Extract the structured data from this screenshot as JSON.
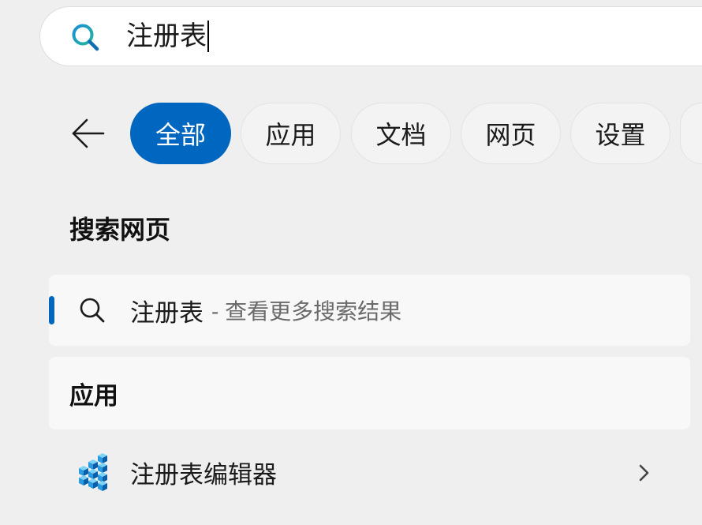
{
  "search": {
    "query": "注册表"
  },
  "filters": [
    {
      "label": "全部",
      "selected": true
    },
    {
      "label": "应用",
      "selected": false
    },
    {
      "label": "文档",
      "selected": false
    },
    {
      "label": "网页",
      "selected": false
    },
    {
      "label": "设置",
      "selected": false
    }
  ],
  "web_section": {
    "heading": "搜索网页",
    "result": {
      "query": "注册表",
      "suffix": "- 查看更多搜索结果"
    }
  },
  "apps_section": {
    "heading": "应用",
    "items": [
      {
        "name": "注册表编辑器",
        "icon": "registry-editor-icon"
      }
    ]
  },
  "icons": {
    "search_box": "search-icon",
    "back": "back-arrow-icon",
    "web_result": "search-icon",
    "app_open": "chevron-right-icon"
  },
  "colors": {
    "accent": "#0067c0",
    "background": "#efefef",
    "card": "#f8f8f8"
  }
}
